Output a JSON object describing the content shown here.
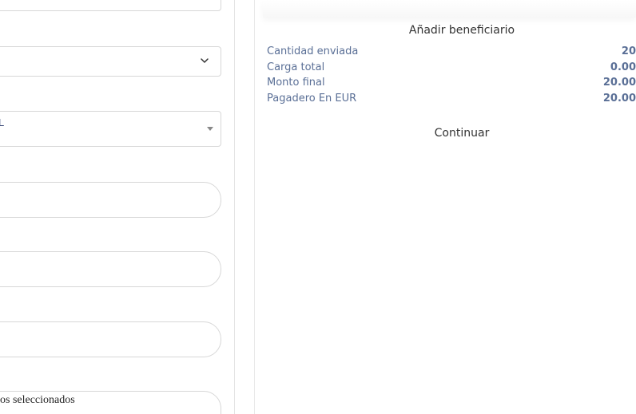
{
  "form": {
    "select2_value": "L",
    "selection_text": "os seleccionados"
  },
  "summary": {
    "add_beneficiary": "Añadir beneficiario",
    "rows": [
      {
        "label": "Cantidad enviada",
        "value": "20"
      },
      {
        "label": "Carga total",
        "value": "0.00"
      },
      {
        "label": "Monto final",
        "value": "20.00"
      },
      {
        "label": "Pagadero En EUR",
        "value": "20.00"
      }
    ],
    "continue_label": "Continuar"
  },
  "icons": {
    "select_chevron": "chevron-down-icon",
    "select2_caret": "caret-down-icon"
  },
  "colors": {
    "summary_text": "#5a6f96",
    "border": "#d7d7d7"
  }
}
